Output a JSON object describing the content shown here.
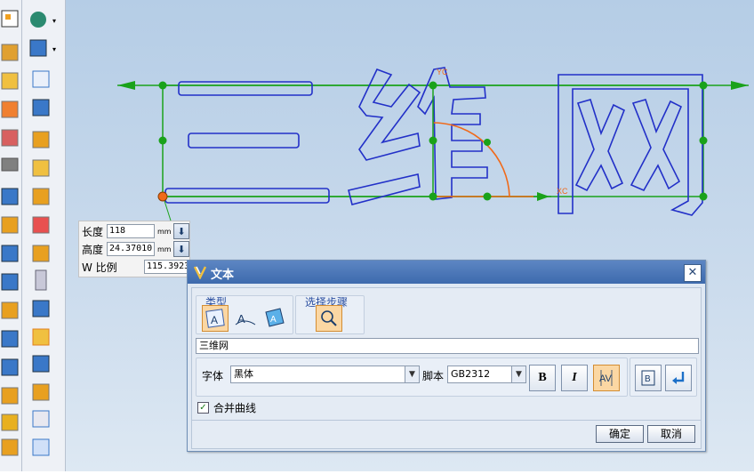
{
  "canvas": {
    "text_preview": "三维网",
    "label_yc": "YC",
    "label_xc": "XC"
  },
  "params": {
    "length_label": "长度",
    "length_value": "118",
    "length_unit": "mm",
    "height_label": "高度",
    "height_value": "24.37010",
    "height_unit": "mm",
    "wscale_label": "W 比例",
    "wscale_value": "115.3923"
  },
  "dialog": {
    "title": "文本",
    "close_icon": "close-icon",
    "type_group_title": "类型",
    "type_options": [
      "planar-text-icon",
      "on-curve-text-icon",
      "on-face-text-icon"
    ],
    "type_selected": 0,
    "step_group_title": "选择步骤",
    "step_icon": "magnifier-icon",
    "text_value": "三维网",
    "font_label": "字体",
    "font_value": "黑体",
    "script_label": "脚本",
    "script_value": "GB2312",
    "bold_label": "B",
    "italic_label": "I",
    "merge_checkbox_label": "合并曲线",
    "merge_checked": true,
    "ok_label": "确定",
    "cancel_label": "取消"
  },
  "colors": {
    "viewport_top": "#b5cde6",
    "text_outline": "#2230c8",
    "frame_green": "#1aa21a",
    "accent_orange": "#f06a1a",
    "selected_btn": "#fbd7a3",
    "title_bar": "#4a74b5"
  }
}
